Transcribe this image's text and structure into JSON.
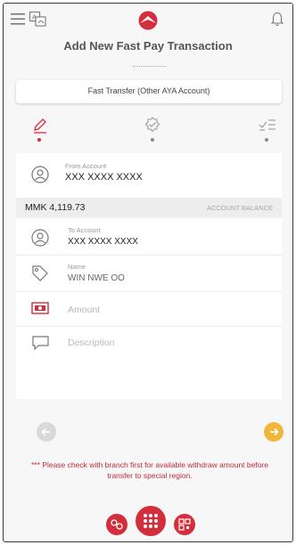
{
  "header": {
    "title": "Add New Fast Pay Transaction",
    "menu_icon": "menu-icon",
    "language_icon": "language-switch-icon",
    "logo_icon": "bank-logo-icon",
    "notification_icon": "bell-icon"
  },
  "transfer_type": {
    "label": "Fast Transfer (Other AYA Account)"
  },
  "steps": [
    {
      "icon": "pencil-icon",
      "active": true
    },
    {
      "icon": "check-badge-icon",
      "active": false
    },
    {
      "icon": "confirm-list-icon",
      "active": false
    }
  ],
  "form": {
    "from_account": {
      "label": "From Account",
      "value": "XXX XXXX XXXX"
    },
    "balance": {
      "value": "MMK 4,119.73",
      "label": "ACCOUNT BALANCE"
    },
    "to_account": {
      "label": "To Account",
      "value": "XXX XXXX XXXX"
    },
    "name": {
      "label": "Name",
      "value": "WIN NWE OO"
    },
    "amount": {
      "placeholder": "Amount"
    },
    "description": {
      "placeholder": "Description"
    }
  },
  "navigation": {
    "back_icon": "arrow-left-icon",
    "next_icon": "arrow-right-icon"
  },
  "notice": "*** Please check with branch first for available withdraw amount before transfer to special region.",
  "bottom_nav": {
    "left_icon": "account-group-icon",
    "center_icon": "keypad-grid-icon",
    "right_icon": "qr-code-icon"
  },
  "colors": {
    "brand_red": "#d42d3c",
    "next_orange": "#f3b63d",
    "notice_red": "#c0283a"
  }
}
